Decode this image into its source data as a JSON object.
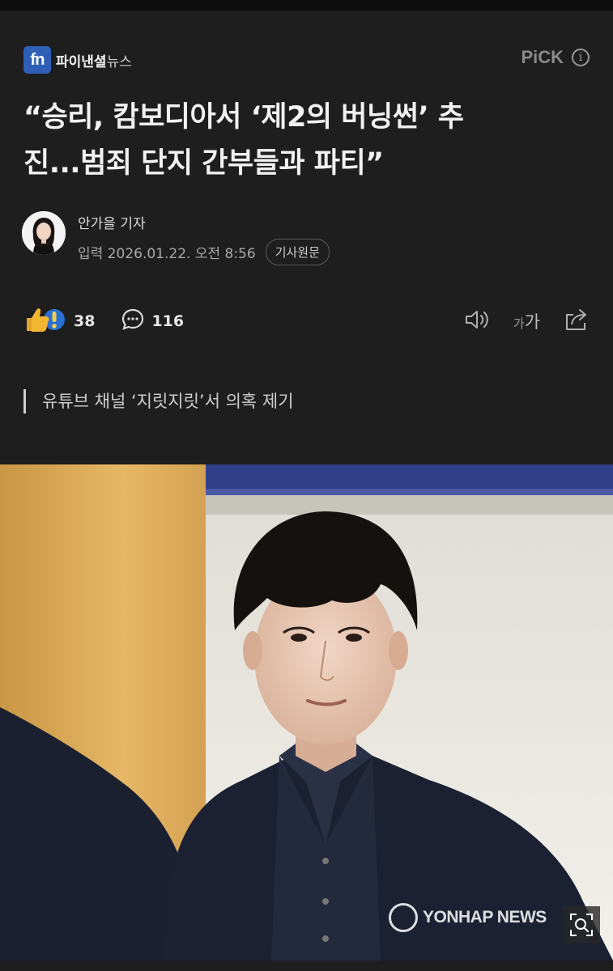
{
  "publisher": {
    "logo_text": "fn",
    "name_main": "파이낸셜",
    "name_sub": "뉴스"
  },
  "pick": {
    "label": "PiCK",
    "info_icon": "info-icon"
  },
  "article": {
    "headline_line1": "“승리, 캄보디아서 ‘제2의 버닝썬’ 추",
    "headline_line2": "진...범죄 단지 간부들과 파티”",
    "reporter": "안가을 기자",
    "date": "입력 2026.01.22. 오전 8:56",
    "original_button": "기사원문",
    "subheading": "유튜브 채널 ‘지릿지릿’서 의혹 제기"
  },
  "actions": {
    "reaction_count": "38",
    "comment_count": "116",
    "reaction_icon": "thumbs-up-exclaim-icon",
    "comment_icon": "speech-bubble-icon",
    "tts_icon": "speaker-icon",
    "font_size_small": "가",
    "font_size_large": "가",
    "share_icon": "share-icon"
  },
  "photo": {
    "watermark": "YONHAP NEWS",
    "zoom_icon": "zoom-icon"
  },
  "colors": {
    "background": "#1e1e1e",
    "brand_blue": "#2f5fb7",
    "reaction_yellow": "#f3b630"
  }
}
